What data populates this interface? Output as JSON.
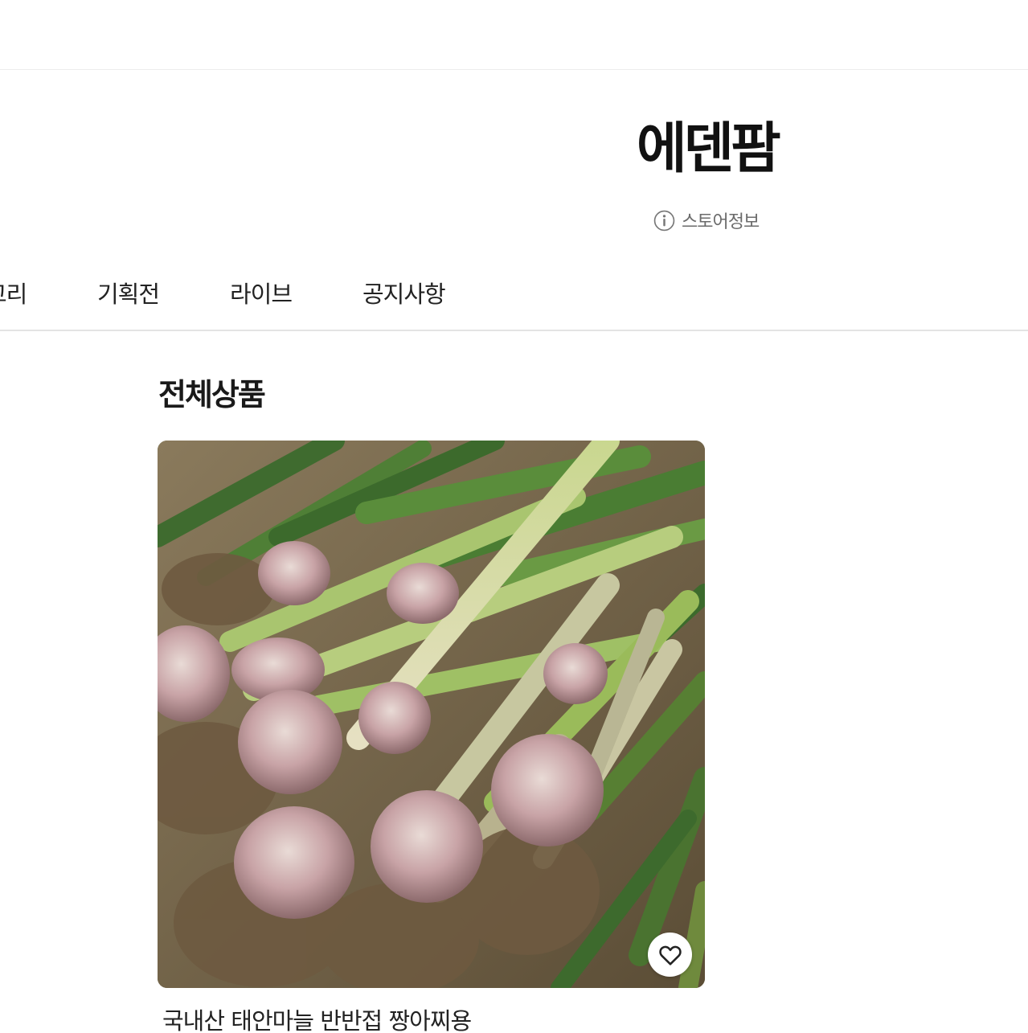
{
  "store": {
    "name": "에덴팜",
    "info_label": "스토어정보",
    "info_icon": "info-circle-icon"
  },
  "nav": {
    "items": [
      {
        "label": "고리"
      },
      {
        "label": "기획전"
      },
      {
        "label": "라이브"
      },
      {
        "label": "공지사항"
      }
    ]
  },
  "section": {
    "title": "전체상품"
  },
  "products": [
    {
      "name": "국내산 태안마늘 반반접 짱아찌용",
      "image": "harvested-garlic-photo",
      "wish_icon": "heart-outline-icon"
    }
  ],
  "colors": {
    "text_primary": "#111111",
    "text_secondary": "#6b6b6b",
    "divider": "#e4e4e4"
  }
}
